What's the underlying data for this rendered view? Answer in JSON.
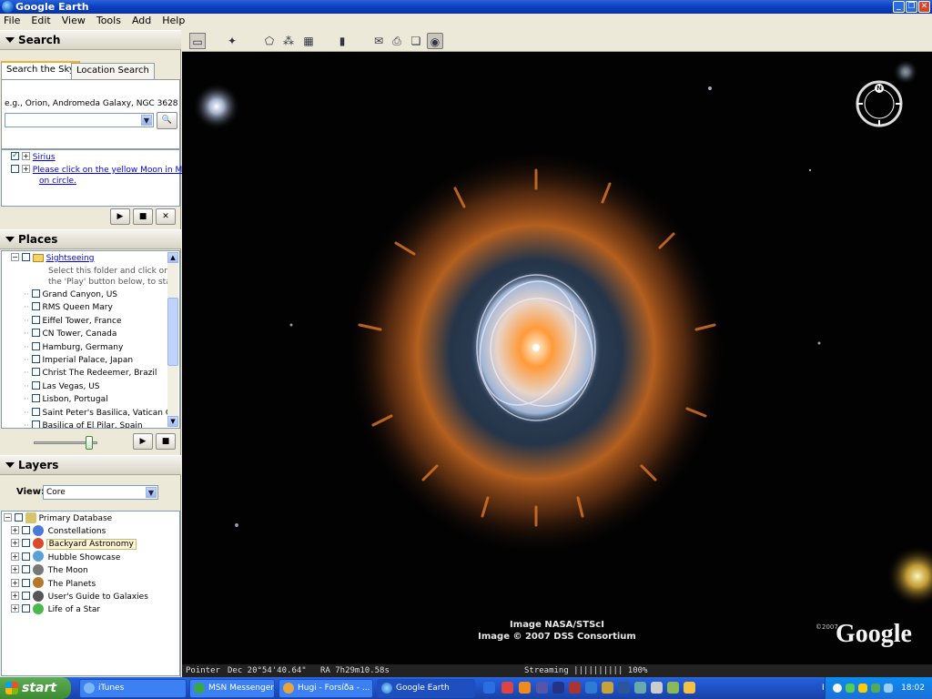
{
  "window": {
    "title": "Google Earth"
  },
  "menu": [
    "File",
    "Edit",
    "View",
    "Tools",
    "Add",
    "Help"
  ],
  "search": {
    "header": "Search",
    "tabs": [
      "Search the Sky",
      "Location Search"
    ],
    "hint": "e.g., Orion, Andromeda Galaxy, NGC 3628",
    "query": "",
    "results": [
      "Sirius",
      "Please click on the yellow Moon in Moti",
      "on circle."
    ]
  },
  "places": {
    "header": "Places",
    "folder": "Sightseeing",
    "folder_note": [
      "Select this folder and click on",
      "the 'Play' button below, to start the"
    ],
    "items": [
      "Grand Canyon, US",
      "RMS Queen Mary",
      "Eiffel Tower, France",
      "CN Tower, Canada",
      "Hamburg, Germany",
      "Imperial Palace, Japan",
      "Christ The Redeemer, Brazil",
      "Las Vegas, US",
      "Lisbon, Portugal",
      "Saint Peter's Basilica, Vatican Cit",
      "Basilica of El Pilar, Spain"
    ],
    "tour_speed": 0.9
  },
  "layers": {
    "header": "Layers",
    "view_label": "View:",
    "view_value": "Core",
    "root": "Primary Database",
    "items": [
      "Constellations",
      "Backyard Astronomy",
      "Hubble Showcase",
      "The Moon",
      "The Planets",
      "User's Guide to Galaxies",
      "Life of a Star"
    ],
    "selected": "Backyard Astronomy"
  },
  "viewer": {
    "credit1": "Image NASA/STScI",
    "credit2": "Image © 2007 DSS Consortium",
    "logo_year": "©2007",
    "logo": "Google",
    "compass_n": "N"
  },
  "status": {
    "pointer": "Pointer",
    "dec": "Dec 20°54'40.64\"",
    "ra": "RA  7h29m10.58s",
    "streaming": "Streaming |||||||||| 100%"
  },
  "taskbar": {
    "start": "start",
    "tasks": [
      "iTunes",
      "MSN Messenger",
      "Hugi - Forsíða - ...",
      "Google Earth"
    ],
    "lang": "IS",
    "clock": "18:02"
  },
  "colors": {
    "accent": "#245edb",
    "nebula_orange": "#e0782a",
    "nebula_blue": "#5a7a9a"
  }
}
